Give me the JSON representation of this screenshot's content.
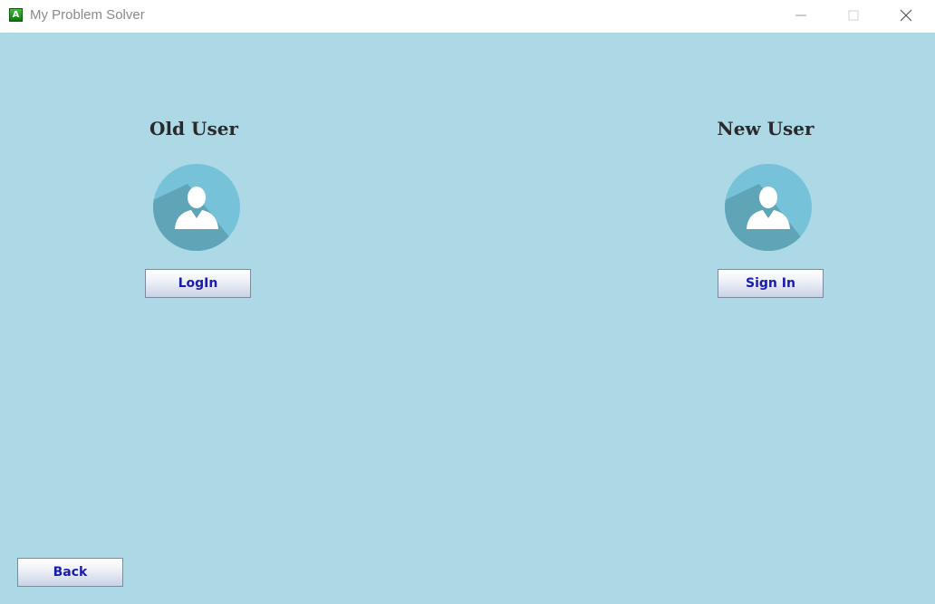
{
  "window": {
    "title": "My Problem Solver",
    "app_icon_letter": "A",
    "controls": [
      "minimize-icon",
      "maximize-icon",
      "close-icon"
    ]
  },
  "old_user": {
    "heading": "Old User",
    "avatar_icon": "user-avatar-icon",
    "button_label": "LogIn"
  },
  "new_user": {
    "heading": "New User",
    "avatar_icon": "user-avatar-icon",
    "button_label": "Sign In"
  },
  "footer": {
    "back_label": "Back"
  },
  "colors": {
    "background": "#add8e6",
    "avatar_circle": "#76c2d8",
    "avatar_shadow": "#5c9fb2",
    "button_text": "#1b1bb0"
  }
}
